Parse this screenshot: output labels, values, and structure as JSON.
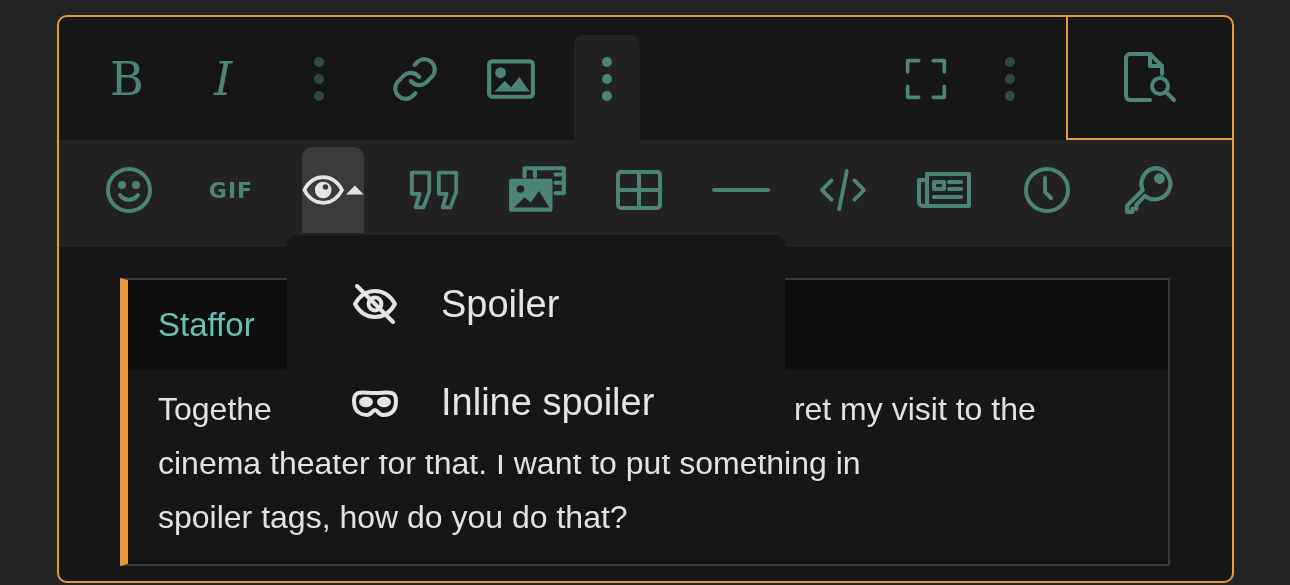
{
  "toolbar_top": {
    "buttons": [
      {
        "kind": "bold",
        "label": "B",
        "selected": false
      },
      {
        "kind": "italic",
        "label": "I",
        "selected": false
      },
      {
        "kind": "separator"
      },
      {
        "kind": "link",
        "selected": false
      },
      {
        "kind": "image",
        "selected": false
      },
      {
        "kind": "more",
        "selected": true
      }
    ],
    "right_buttons": [
      {
        "kind": "fullscreen",
        "selected": false
      },
      {
        "kind": "separator"
      }
    ],
    "preview_button": {
      "outlined": true
    }
  },
  "toolbar_bottom": {
    "buttons": [
      {
        "kind": "smiley",
        "selected": false,
        "expanded": false
      },
      {
        "kind": "gif",
        "label": "GIF",
        "selected": false,
        "expanded": false
      },
      {
        "kind": "eye",
        "selected": true,
        "expanded": true
      },
      {
        "kind": "quote",
        "selected": false,
        "expanded": false
      },
      {
        "kind": "media",
        "selected": false,
        "expanded": false
      },
      {
        "kind": "table",
        "selected": false,
        "expanded": false
      },
      {
        "kind": "rule",
        "selected": false,
        "expanded": false
      },
      {
        "kind": "code",
        "selected": false,
        "expanded": false
      },
      {
        "kind": "article",
        "selected": false,
        "expanded": false
      },
      {
        "kind": "clock",
        "selected": false,
        "expanded": false
      },
      {
        "kind": "key",
        "selected": false,
        "expanded": false
      }
    ]
  },
  "dropdown": {
    "items": [
      {
        "kind": "eye-slash",
        "label": "Spoiler"
      },
      {
        "kind": "mask",
        "label": "Inline spoiler"
      }
    ]
  },
  "quote": {
    "author": "Staffor",
    "lines": [
      [
        "Togethe",
        "ret my visit to the"
      ],
      [
        "cinema theater for that. I want to put something in"
      ],
      [
        "spoiler tags, how do you do that?"
      ]
    ]
  }
}
